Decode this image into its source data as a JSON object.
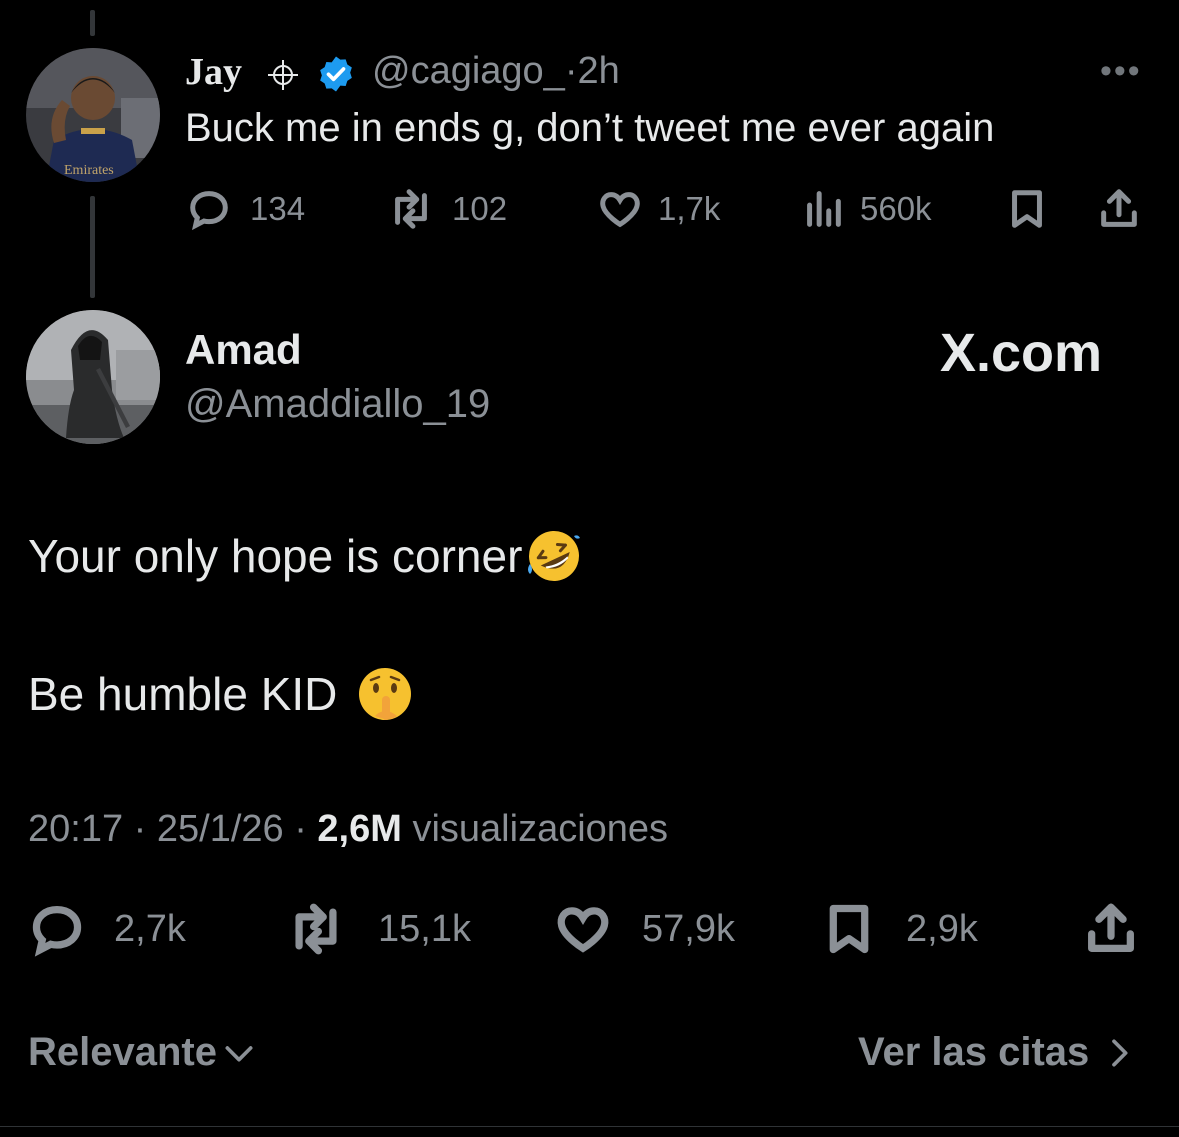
{
  "parent_tweet": {
    "display_name": "Jay",
    "handle": "@cagiago_",
    "separator": "·",
    "time": "2h",
    "text": "Buck me in ends g, don’t tweet me ever again",
    "more": "•••",
    "replies": "134",
    "reposts": "102",
    "likes": "1,7k",
    "views": "560k"
  },
  "main_tweet": {
    "display_name": "Amad",
    "handle": "@Amaddiallo_19",
    "watermark": "X.com",
    "line1": "Your only hope is corner",
    "line2": "Be humble KID",
    "time": "20:17 · 25/1/26 ·",
    "views_count": "2,6M",
    "views_label": "visualizaciones",
    "replies": "2,7k",
    "reposts": "15,1k",
    "likes": "57,9k",
    "bookmarks": "2,9k"
  },
  "footer": {
    "sort_label": "Relevante",
    "quotes_label": "Ver las citas"
  },
  "colors": {
    "background": "#000000",
    "text": "#e7e9ea",
    "muted": "#8b9096",
    "verified": "#1d9bf0"
  }
}
